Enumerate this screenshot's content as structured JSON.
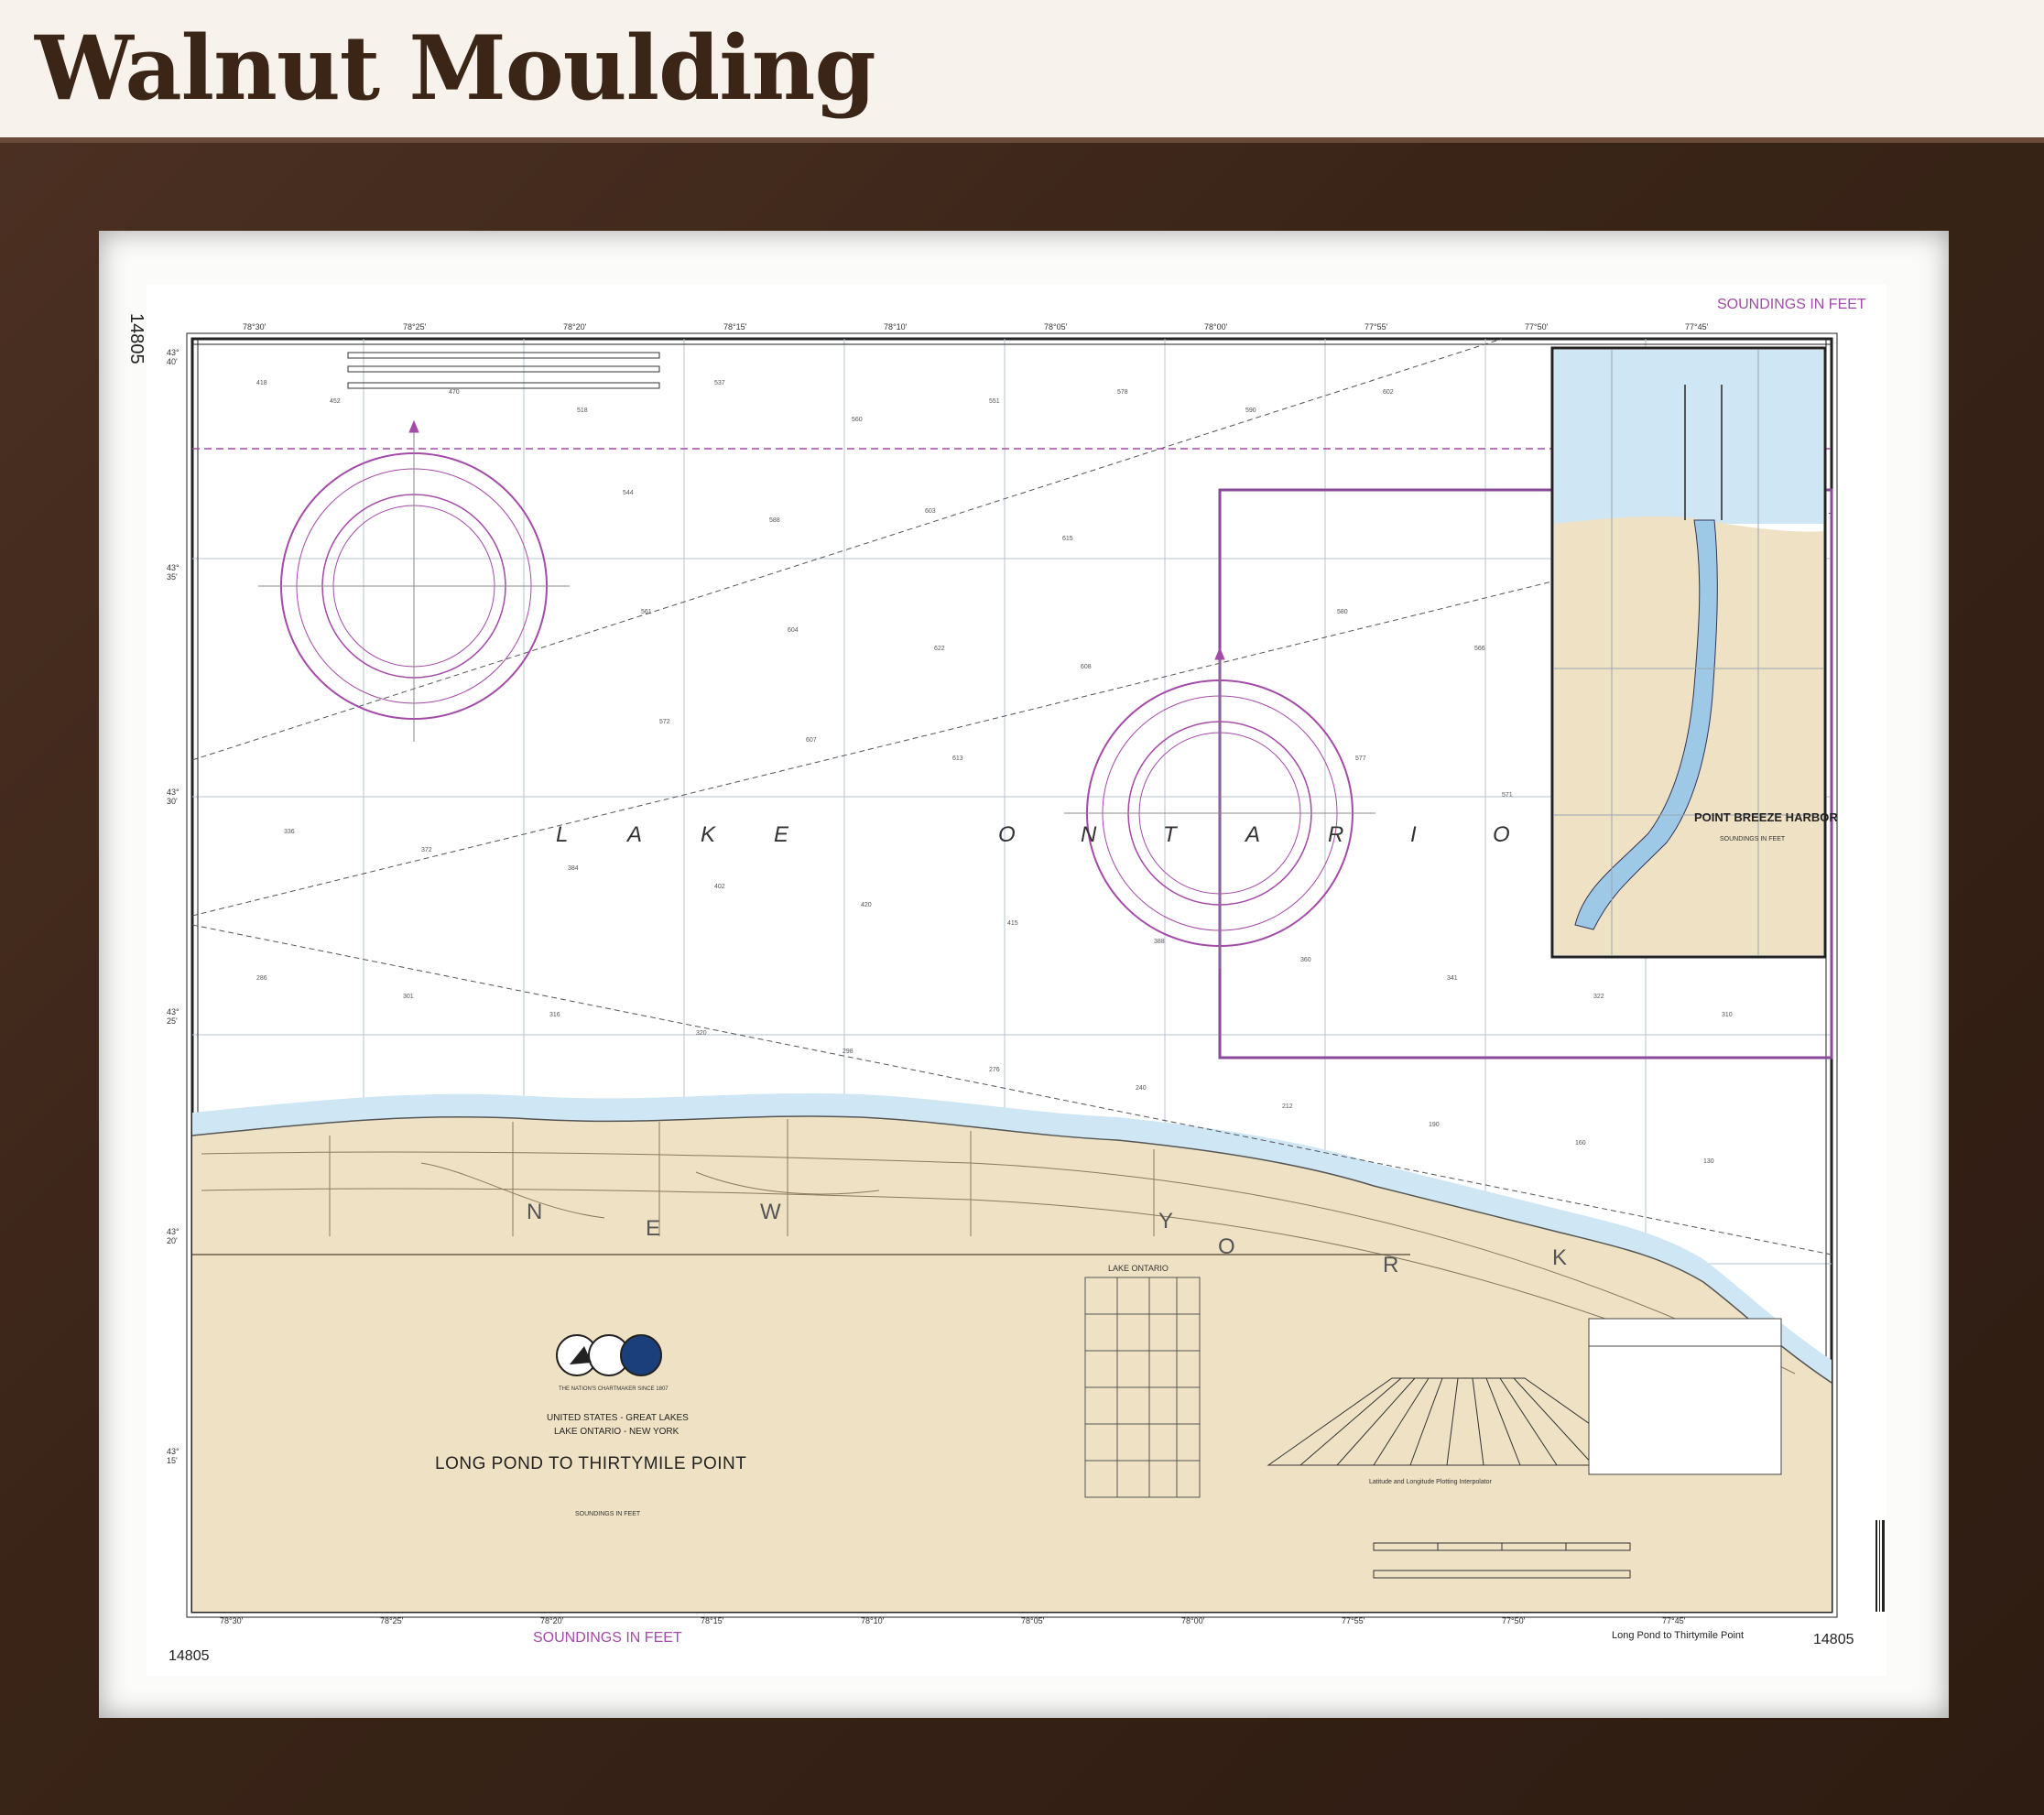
{
  "header": {
    "title": "Walnut Moulding"
  },
  "chart": {
    "number": "14805",
    "soundings": "SOUNDINGS IN FEET",
    "lake_letters": [
      "L",
      "A",
      "K",
      "E",
      "O",
      "N",
      "T",
      "A",
      "R",
      "I",
      "O"
    ],
    "state_letters": [
      "N",
      "E",
      "W",
      "Y",
      "O",
      "R",
      "K"
    ],
    "inset_title": "POINT BREEZE HARBOR",
    "inset_subtitle": "SOUNDINGS IN FEET",
    "title_line1": "UNITED STATES - GREAT LAKES",
    "title_line2": "LAKE ONTARIO - NEW YORK",
    "main_title": "LONG POND TO THIRTYMILE POINT",
    "title_soundings": "SOUNDINGS IN FEET",
    "footer_title": "Long Pond to Thirtymile Point",
    "lake_graph_title": "LAKE ONTARIO",
    "interpolator_label": "Latitude and Longitude Plotting Interpolator",
    "seal_caption": "THE NATION'S CHARTMAKER SINCE 1807",
    "top_lon_labels": [
      "78°30'",
      "78°25'",
      "78°20'",
      "78°15'",
      "78°10'",
      "78°05'",
      "78°00'",
      "77°55'",
      "77°50'",
      "77°45'"
    ],
    "bottom_lon_labels": [
      "78°30'",
      "78°25'",
      "78°20'",
      "78°15'",
      "78°10'",
      "78°05'",
      "78°00'",
      "77°55'",
      "77°50'",
      "77°45'"
    ],
    "lat_labels": [
      "43° 40'",
      "43° 35'",
      "43° 30'",
      "43° 25'",
      "43° 20'",
      "43° 15'"
    ],
    "colors": {
      "frame": "#3a2418",
      "land": "#efe2c4",
      "shallow_water": "#d4eaf6",
      "magenta": "#a44aa8",
      "grid": "#9aa6b4"
    }
  }
}
